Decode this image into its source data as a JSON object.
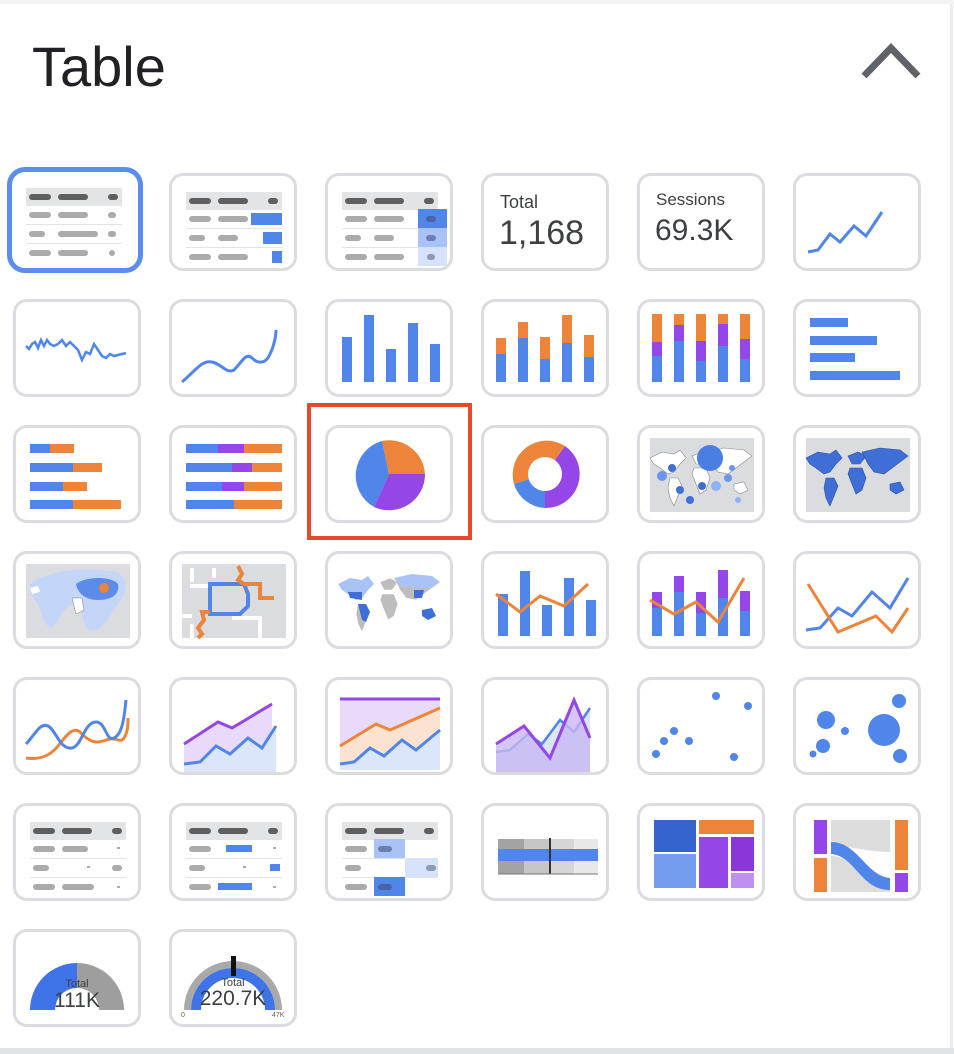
{
  "panel": {
    "title": "Table",
    "collapse_icon": "chevron-up-icon"
  },
  "colors": {
    "blue": "#5085ea",
    "orange": "#ec843a",
    "purple": "#9446e6",
    "grey_border": "#dadce0",
    "selected_border": "#5b8def",
    "highlight": "#e64a2e"
  },
  "chart_types": [
    {
      "id": "table",
      "label": "Table",
      "selected": true
    },
    {
      "id": "table-bars",
      "label": "Table with bars"
    },
    {
      "id": "table-heatmap",
      "label": "Table with heatmap"
    },
    {
      "id": "scorecard",
      "label": "Scorecard",
      "metric_label": "Total",
      "metric_value": "1,168"
    },
    {
      "id": "scorecard-compact",
      "label": "Scorecard compact",
      "metric_label": "Sessions",
      "metric_value": "69.3K"
    },
    {
      "id": "time-series",
      "label": "Time series"
    },
    {
      "id": "sparkline",
      "label": "Sparkline"
    },
    {
      "id": "smoothed-time-series",
      "label": "Smoothed time series"
    },
    {
      "id": "column",
      "label": "Column chart"
    },
    {
      "id": "stacked-column",
      "label": "Stacked column chart"
    },
    {
      "id": "100-stacked-column",
      "label": "100% stacked column chart"
    },
    {
      "id": "bar",
      "label": "Bar chart"
    },
    {
      "id": "stacked-bar",
      "label": "Stacked bar chart"
    },
    {
      "id": "100-stacked-bar",
      "label": "100% stacked bar chart"
    },
    {
      "id": "pie",
      "label": "Pie chart",
      "highlighted": true
    },
    {
      "id": "donut",
      "label": "Donut chart"
    },
    {
      "id": "bubble-map",
      "label": "Bubble map"
    },
    {
      "id": "filled-map",
      "label": "Filled map"
    },
    {
      "id": "heatmap-map",
      "label": "Heatmap"
    },
    {
      "id": "line-map",
      "label": "Line map"
    },
    {
      "id": "geo-chart",
      "label": "Geo chart"
    },
    {
      "id": "combo",
      "label": "Combo chart"
    },
    {
      "id": "stacked-combo",
      "label": "Stacked combo chart"
    },
    {
      "id": "line",
      "label": "Line chart"
    },
    {
      "id": "smoothed-line",
      "label": "Smoothed line chart"
    },
    {
      "id": "stacked-area",
      "label": "Stacked area"
    },
    {
      "id": "100-stacked-area",
      "label": "100% stacked area"
    },
    {
      "id": "area",
      "label": "Area chart"
    },
    {
      "id": "scatter",
      "label": "Scatter chart"
    },
    {
      "id": "bubble",
      "label": "Bubble chart"
    },
    {
      "id": "pivot-table",
      "label": "Pivot table"
    },
    {
      "id": "pivot-table-bars",
      "label": "Pivot table with bars"
    },
    {
      "id": "pivot-table-heatmap",
      "label": "Pivot table with heatmap"
    },
    {
      "id": "bullet",
      "label": "Bullet chart"
    },
    {
      "id": "treemap",
      "label": "Treemap"
    },
    {
      "id": "sankey",
      "label": "Sankey"
    },
    {
      "id": "gauge",
      "label": "Gauge",
      "metric_label": "Total",
      "metric_value": "111K"
    },
    {
      "id": "gauge-range",
      "label": "Gauge with range",
      "metric_label": "Total",
      "metric_value": "220.7K",
      "min_label": "0",
      "max_label": "47K"
    }
  ]
}
